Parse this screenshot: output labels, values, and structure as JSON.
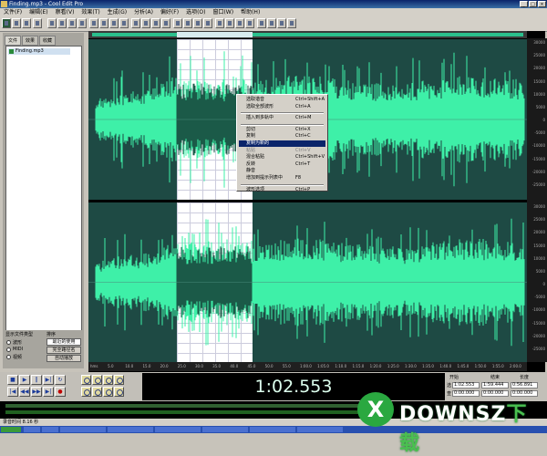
{
  "window": {
    "title": "Finding.mp3 - Cool Edit Pro",
    "buttons": [
      "_",
      "□",
      "×"
    ]
  },
  "menu": [
    "文件(F)",
    "编辑(E)",
    "察看(V)",
    "效果(T)",
    "生成(G)",
    "分析(A)",
    "偏好(F)",
    "选项(O)",
    "窗口(W)",
    "帮助(H)"
  ],
  "left_panel": {
    "tabs": [
      "文件",
      "效果",
      "收藏"
    ],
    "files": [
      {
        "name": "Finding.mp3"
      }
    ],
    "display_label": "显示文件类型",
    "sort_label": "排序",
    "options": [
      "波形",
      "MIDI",
      "视频"
    ],
    "sort_value": "最近的使用",
    "btn_full_name": "完全路径名",
    "btn_auto_play": "自动播放"
  },
  "context_menu": {
    "items": [
      {
        "label": "选取谐音",
        "shortcut": "Ctrl+Shift+A"
      },
      {
        "label": "选取全部波形",
        "shortcut": "Ctrl+A"
      },
      {
        "sep": true
      },
      {
        "label": "插入到多轨中",
        "shortcut": "Ctrl+M"
      },
      {
        "sep": true
      },
      {
        "label": "剪切",
        "shortcut": "Ctrl+X"
      },
      {
        "label": "复制",
        "shortcut": "Ctrl+C"
      },
      {
        "label": "复制为新的",
        "shortcut": "",
        "highlighted": true
      },
      {
        "label": "粘贴",
        "shortcut": "Ctrl+V",
        "disabled": true
      },
      {
        "label": "混合粘贴",
        "shortcut": "Ctrl+Shift+V"
      },
      {
        "label": "反转",
        "shortcut": "Ctrl+T"
      },
      {
        "label": "静音",
        "shortcut": ""
      },
      {
        "label": "增加到提示列表中",
        "shortcut": "F8"
      },
      {
        "sep": true
      },
      {
        "label": "波形选项",
        "shortcut": "Ctrl+P"
      }
    ]
  },
  "timecode": "1:02.553",
  "info": {
    "headers": [
      "开始",
      "结束",
      "长度"
    ],
    "sel_label": "选",
    "view_label": "查",
    "sel": [
      "1:02.553",
      "1:59.444",
      "0:56.891"
    ],
    "view": [
      "0:00.000",
      "0:00.000",
      "0:00.000"
    ]
  },
  "status": {
    "left": "录音时间 8.16 秒"
  },
  "watermark": {
    "x": "X",
    "text": "DOWNSZ",
    "cn": "下载"
  },
  "scale_top": [
    "30000",
    "25000",
    "20000",
    "15000",
    "10000",
    "5000",
    "0",
    "-5000",
    "-10000",
    "-15000",
    "-20000",
    "-25000"
  ],
  "scale_bottom": [
    "30000",
    "25000",
    "20000",
    "15000",
    "10000",
    "5000",
    "0",
    "-5000",
    "-10000",
    "-15000",
    "-20000",
    "-25000"
  ],
  "ruler": [
    "hms",
    "5.0",
    "10.0",
    "15.0",
    "20.0",
    "25.0",
    "30.0",
    "35.0",
    "40.0",
    "45.0",
    "50.0",
    "55.0",
    "1:00.0",
    "1:05.0",
    "1:10.0",
    "1:15.0",
    "1:20.0",
    "1:25.0",
    "1:30.0",
    "1:35.0",
    "1:40.0",
    "1:45.0",
    "1:50.0",
    "1:55.0",
    "2:00.0"
  ],
  "colors": {
    "wave": "#3ef0a8",
    "wave_dark": "#1b5a48",
    "bg": "#000000",
    "selection": "#ffffff"
  }
}
